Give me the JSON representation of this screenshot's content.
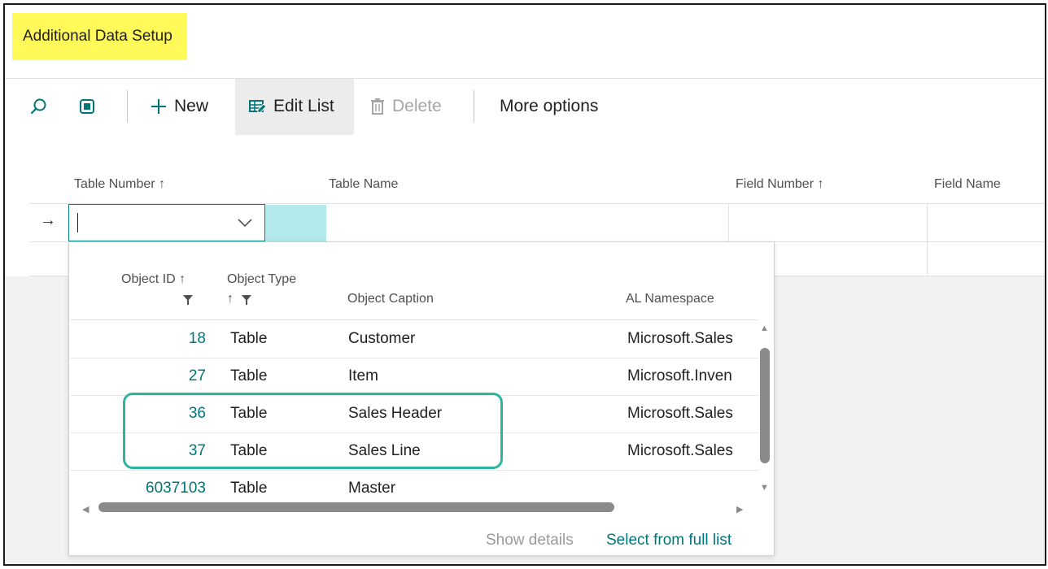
{
  "page": {
    "title": "Additional Data Setup"
  },
  "toolbar": {
    "new_label": "New",
    "edit_list_label": "Edit List",
    "delete_label": "Delete",
    "more_options_label": "More options",
    "icons": [
      "search-icon",
      "layout-icon",
      "plus-icon",
      "edit-list-icon",
      "trash-icon"
    ]
  },
  "list": {
    "columns": [
      "Table Number",
      "Table Name",
      "Field Number",
      "Field Name"
    ],
    "row_indicator": "→"
  },
  "dropdown": {
    "columns": {
      "object_id": "Object ID",
      "object_type": "Object Type",
      "object_caption": "Object Caption",
      "al_namespace": "AL Namespace"
    },
    "rows": [
      {
        "id": "18",
        "type": "Table",
        "caption": "Customer",
        "namespace": "Microsoft.Sales"
      },
      {
        "id": "27",
        "type": "Table",
        "caption": "Item",
        "namespace": "Microsoft.Inven"
      },
      {
        "id": "36",
        "type": "Table",
        "caption": "Sales Header",
        "namespace": "Microsoft.Sales"
      },
      {
        "id": "37",
        "type": "Table",
        "caption": "Sales Line",
        "namespace": "Microsoft.Sales"
      },
      {
        "id": "6037103",
        "type": "Table",
        "caption": "Master",
        "namespace": ""
      }
    ],
    "show_details_label": "Show details",
    "select_full_list_label": "Select from full list"
  },
  "colors": {
    "title_highlight": "#fff959",
    "accent": "#00757a",
    "selected_cell": "#b3e8ec",
    "annotation_outline": "#2db3a0"
  }
}
